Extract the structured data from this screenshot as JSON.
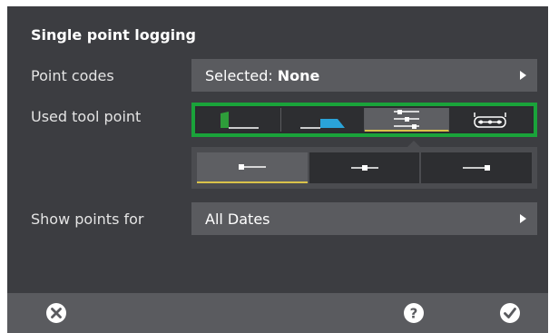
{
  "dialog": {
    "title": "Single point logging",
    "point_codes": {
      "label": "Point codes",
      "value_prefix": "Selected:",
      "value": "None"
    },
    "used_tool_point": {
      "label": "Used tool point",
      "tools": [
        {
          "icon": "bucket-left-edge-icon",
          "selected": false
        },
        {
          "icon": "bucket-right-edge-icon",
          "selected": false
        },
        {
          "icon": "blade-adjust-icon",
          "selected": true
        },
        {
          "icon": "track-undercarriage-icon",
          "selected": false
        }
      ],
      "sub_points": [
        {
          "icon": "point-left-icon",
          "selected": true
        },
        {
          "icon": "point-center-icon",
          "selected": false
        },
        {
          "icon": "point-right-icon",
          "selected": false
        }
      ]
    },
    "show_points_for": {
      "label": "Show points for",
      "value": "All Dates"
    }
  },
  "footer": {
    "cancel_icon": "close-circle-icon",
    "help_icon": "help-icon",
    "confirm_icon": "check-circle-icon"
  },
  "colors": {
    "background": "#3c3d41",
    "field": "#5a5b5f",
    "highlight_border": "#1aa33a",
    "selected_underline": "#d9c24a",
    "accent_green": "#2e9d3a",
    "accent_blue": "#2aa3d8"
  }
}
